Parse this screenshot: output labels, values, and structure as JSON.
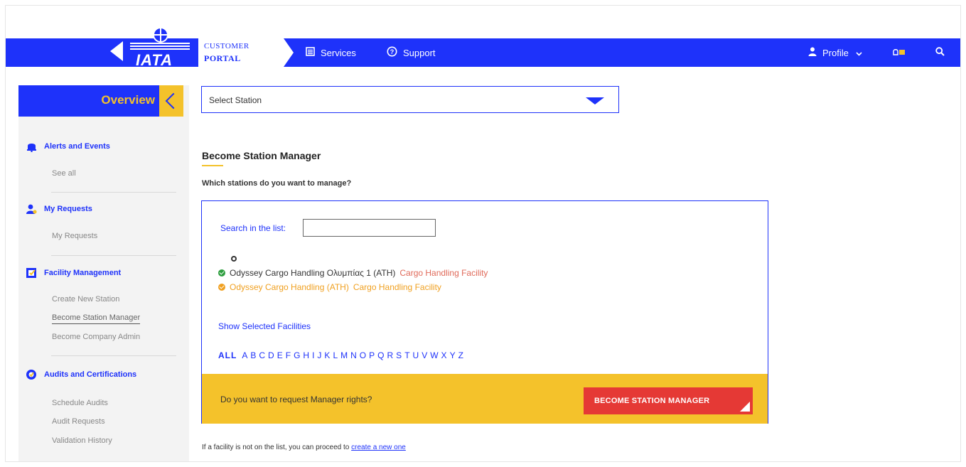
{
  "header": {
    "logo_text": "IATA",
    "portal_line1": "CUSTOMER",
    "portal_line2": "PORTAL",
    "services_label": "Services",
    "support_label": "Support",
    "profile_label": "Profile"
  },
  "sidebar": {
    "overview_label": "Overview",
    "sections": [
      {
        "title": "Alerts and Events",
        "items": [
          "See all"
        ]
      },
      {
        "title": "My Requests",
        "items": [
          "My Requests"
        ]
      },
      {
        "title": "Facility Management",
        "items": [
          "Create New Station",
          "Become Station Manager",
          "Become Company Admin"
        ]
      },
      {
        "title": "Audits and Certifications",
        "items": [
          "Schedule Audits",
          "Audit Requests",
          "Validation History"
        ]
      }
    ]
  },
  "main": {
    "select_station": "Select Station",
    "title": "Become Station Manager",
    "subtitle": "Which stations do you want to manage?",
    "search_label": "Search in the list:",
    "search_value": "",
    "facilities": [
      {
        "name": "Odyssey Cargo Handling Ολυμπίας 1 (ATH)",
        "type": "Cargo Handling Facility",
        "status_color": "#2e9e3f",
        "name_color": "#333333",
        "type_color": "#e06a5a"
      },
      {
        "name": "Odyssey Cargo Handling (ATH)",
        "type": "Cargo Handling Facility",
        "status_color": "#f0a020",
        "name_color": "#f0a020",
        "type_color": "#f0a020"
      }
    ],
    "show_selected": "Show Selected Facilities",
    "alphabet_all": "ALL",
    "alphabet": [
      "A",
      "B",
      "C",
      "D",
      "E",
      "F",
      "G",
      "H",
      "I",
      "J",
      "K",
      "L",
      "M",
      "N",
      "O",
      "P",
      "Q",
      "R",
      "S",
      "T",
      "U",
      "V",
      "W",
      "X",
      "Y",
      "Z"
    ],
    "request_question": "Do you want to request Manager rights?",
    "become_button": "BECOME STATION MANAGER",
    "footer_text": "If a facility is not on the list, you can proceed to",
    "footer_link": "create a new one"
  },
  "colors": {
    "brand_blue": "#1e32fa",
    "accent_yellow": "#f4c22b",
    "cta_red": "#e53935"
  },
  "icons": {
    "services": "services-icon",
    "support": "support-icon",
    "profile": "user-icon",
    "notifications": "notification-icon",
    "search": "search-icon"
  }
}
